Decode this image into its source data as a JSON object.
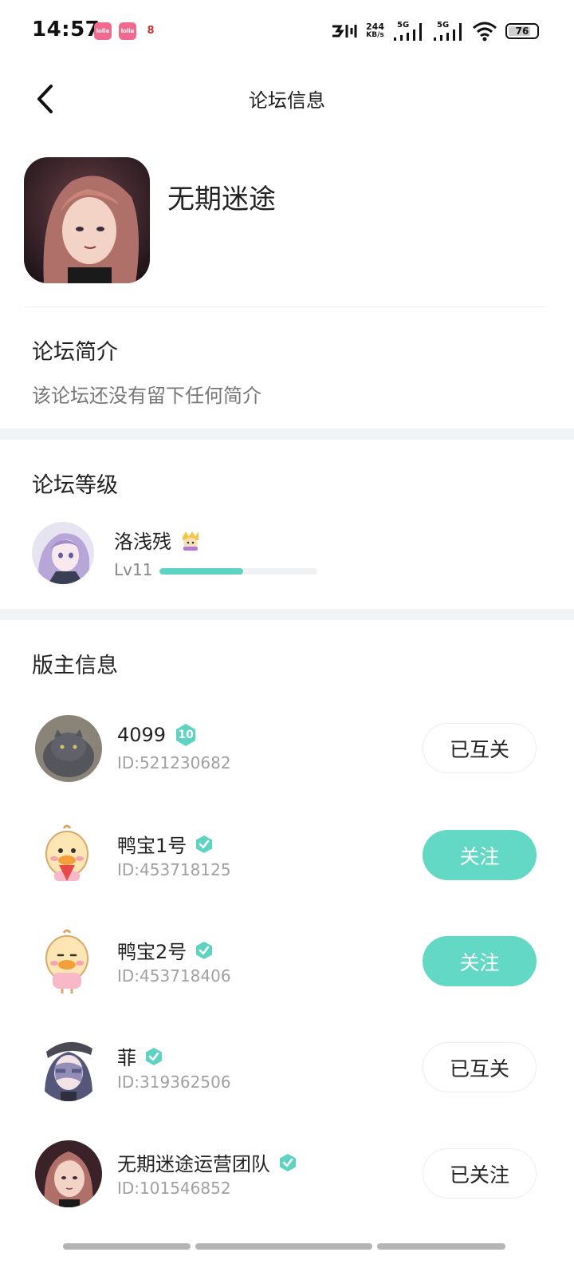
{
  "status_bar": {
    "time": "14:57",
    "notif_1": "lolla",
    "notif_2": "lolla",
    "notif_3": "8",
    "net_speed_value": "244",
    "net_speed_unit": "KB/s",
    "signal_1": "5G",
    "signal_2": "5G",
    "battery": "76"
  },
  "header": {
    "title": "论坛信息"
  },
  "forum": {
    "name": "无期迷途"
  },
  "intro": {
    "title": "论坛简介",
    "text": "该论坛还没有留下任何简介"
  },
  "level": {
    "title": "论坛等级",
    "user_name": "洛浅残",
    "level_label": "Lv11",
    "progress": 0.53
  },
  "moderators": {
    "title": "版主信息",
    "items": [
      {
        "name": "4099",
        "level_badge": "10",
        "id": "ID:521230682",
        "button": "已互关",
        "button_style": "outline"
      },
      {
        "name": "鸭宝1号",
        "id": "ID:453718125",
        "button": "关注",
        "button_style": "solid"
      },
      {
        "name": "鸭宝2号",
        "id": "ID:453718406",
        "button": "关注",
        "button_style": "solid"
      },
      {
        "name": "菲",
        "id": "ID:319362506",
        "button": "已互关",
        "button_style": "outline"
      },
      {
        "name": "无期迷途运营团队",
        "id": "ID:101546852",
        "button": "已关注",
        "button_style": "outline"
      }
    ]
  },
  "colors": {
    "accent": "#62d8c5",
    "divider": "#f2f3f5"
  },
  "icons": {
    "back": "chevron-left-icon",
    "verified": "verified-shield-icon",
    "level_badge": "level-badge-icon"
  }
}
